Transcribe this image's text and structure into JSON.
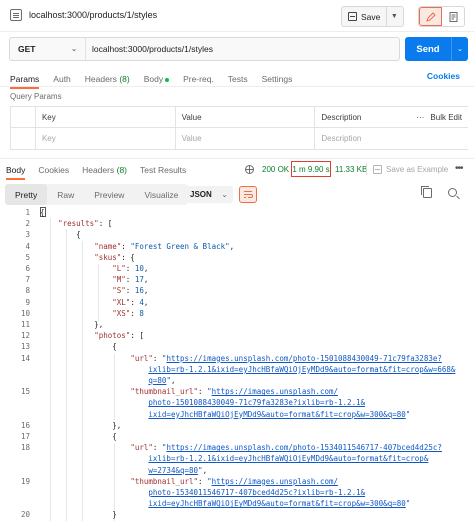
{
  "header": {
    "title": "localhost:3000/products/1/styles",
    "save_label": "Save"
  },
  "request": {
    "method": "GET",
    "url": "localhost:3000/products/1/styles",
    "send_label": "Send"
  },
  "request_tabs": {
    "params": "Params",
    "auth": "Auth",
    "headers": "Headers",
    "headers_count": "(8)",
    "body": "Body",
    "prereq": "Pre-req.",
    "tests": "Tests",
    "settings": "Settings",
    "cookies": "Cookies"
  },
  "query_params": {
    "label": "Query Params",
    "columns": [
      "Key",
      "Value",
      "Description"
    ],
    "bulk_edit": "Bulk Edit",
    "placeholders": [
      "Key",
      "Value",
      "Description"
    ]
  },
  "response": {
    "tabs": {
      "body": "Body",
      "cookies": "Cookies",
      "headers": "Headers",
      "headers_count": "(8)",
      "test_results": "Test Results"
    },
    "status": "200 OK",
    "time": "1 m 9.90 s",
    "size": "11.33 KB",
    "save_example": "Save as Example",
    "format_tabs": [
      "Pretty",
      "Raw",
      "Preview",
      "Visualize"
    ],
    "format": "JSON"
  },
  "code_lines": [
    {
      "n": "1",
      "t": "{"
    },
    {
      "n": "2",
      "t": "    \"results\": ["
    },
    {
      "n": "3",
      "t": "        {"
    },
    {
      "n": "4",
      "t": "            \"name\": \"Forest Green & Black\","
    },
    {
      "n": "5",
      "t": "            \"skus\": {"
    },
    {
      "n": "6",
      "t": "                \"L\": 10,"
    },
    {
      "n": "7",
      "t": "                \"M\": 17,"
    },
    {
      "n": "8",
      "t": "                \"S\": 16,"
    },
    {
      "n": "9",
      "t": "                \"XL\": 4,"
    },
    {
      "n": "10",
      "t": "                \"XS\": 8"
    },
    {
      "n": "11",
      "t": "            },"
    },
    {
      "n": "12",
      "t": "            \"photos\": ["
    },
    {
      "n": "13",
      "t": "                {"
    },
    {
      "n": "14",
      "t": "                    \"url\": \"https://images.unsplash.com/photo-1501088430049-71c79fa3283e?"
    },
    {
      "n": "",
      "t": "                        ixlib=rb-1.2.1&ixid=eyJhcHBfaWQiOjEyMDd9&auto=format&fit=crop&w=668&"
    },
    {
      "n": "",
      "t": "                        q=80\","
    },
    {
      "n": "15",
      "t": "                    \"thumbnail_url\": \"https://images.unsplash.com/"
    },
    {
      "n": "",
      "t": "                        photo-1501088430049-71c79fa3283e?ixlib=rb-1.2.1&"
    },
    {
      "n": "",
      "t": "                        ixid=eyJhcHBfaWQiOjEyMDd9&auto=format&fit=crop&w=300&q=80\""
    },
    {
      "n": "16",
      "t": "                },"
    },
    {
      "n": "17",
      "t": "                {"
    },
    {
      "n": "18",
      "t": "                    \"url\": \"https://images.unsplash.com/photo-1534011546717-407bced4d25c?"
    },
    {
      "n": "",
      "t": "                        ixlib=rb-1.2.1&ixid=eyJhcHBfaWQiOjEyMDd9&auto=format&fit=crop&"
    },
    {
      "n": "",
      "t": "                        w=2734&q=80\","
    },
    {
      "n": "19",
      "t": "                    \"thumbnail_url\": \"https://images.unsplash.com/"
    },
    {
      "n": "",
      "t": "                        photo-1534011546717-407bced4d25c?ixlib=rb-1.2.1&"
    },
    {
      "n": "",
      "t": "                        ixid=eyJhcHBfaWQiOjEyMDd9&auto=format&fit=crop&w=300&q=80\""
    },
    {
      "n": "20",
      "t": "                }"
    }
  ],
  "colors": {
    "accent": "#ff6c37",
    "send": "#097bed",
    "status_ok": "#0a7d2b",
    "highlight_border": "#e23e2e"
  },
  "icons": {
    "request": "request-icon",
    "save": "disk-icon",
    "edit": "pencil-icon",
    "docs": "document-icon",
    "globe": "globe-icon",
    "copy": "copy-icon",
    "search": "search-icon",
    "wrap": "wrap-lines-icon"
  }
}
